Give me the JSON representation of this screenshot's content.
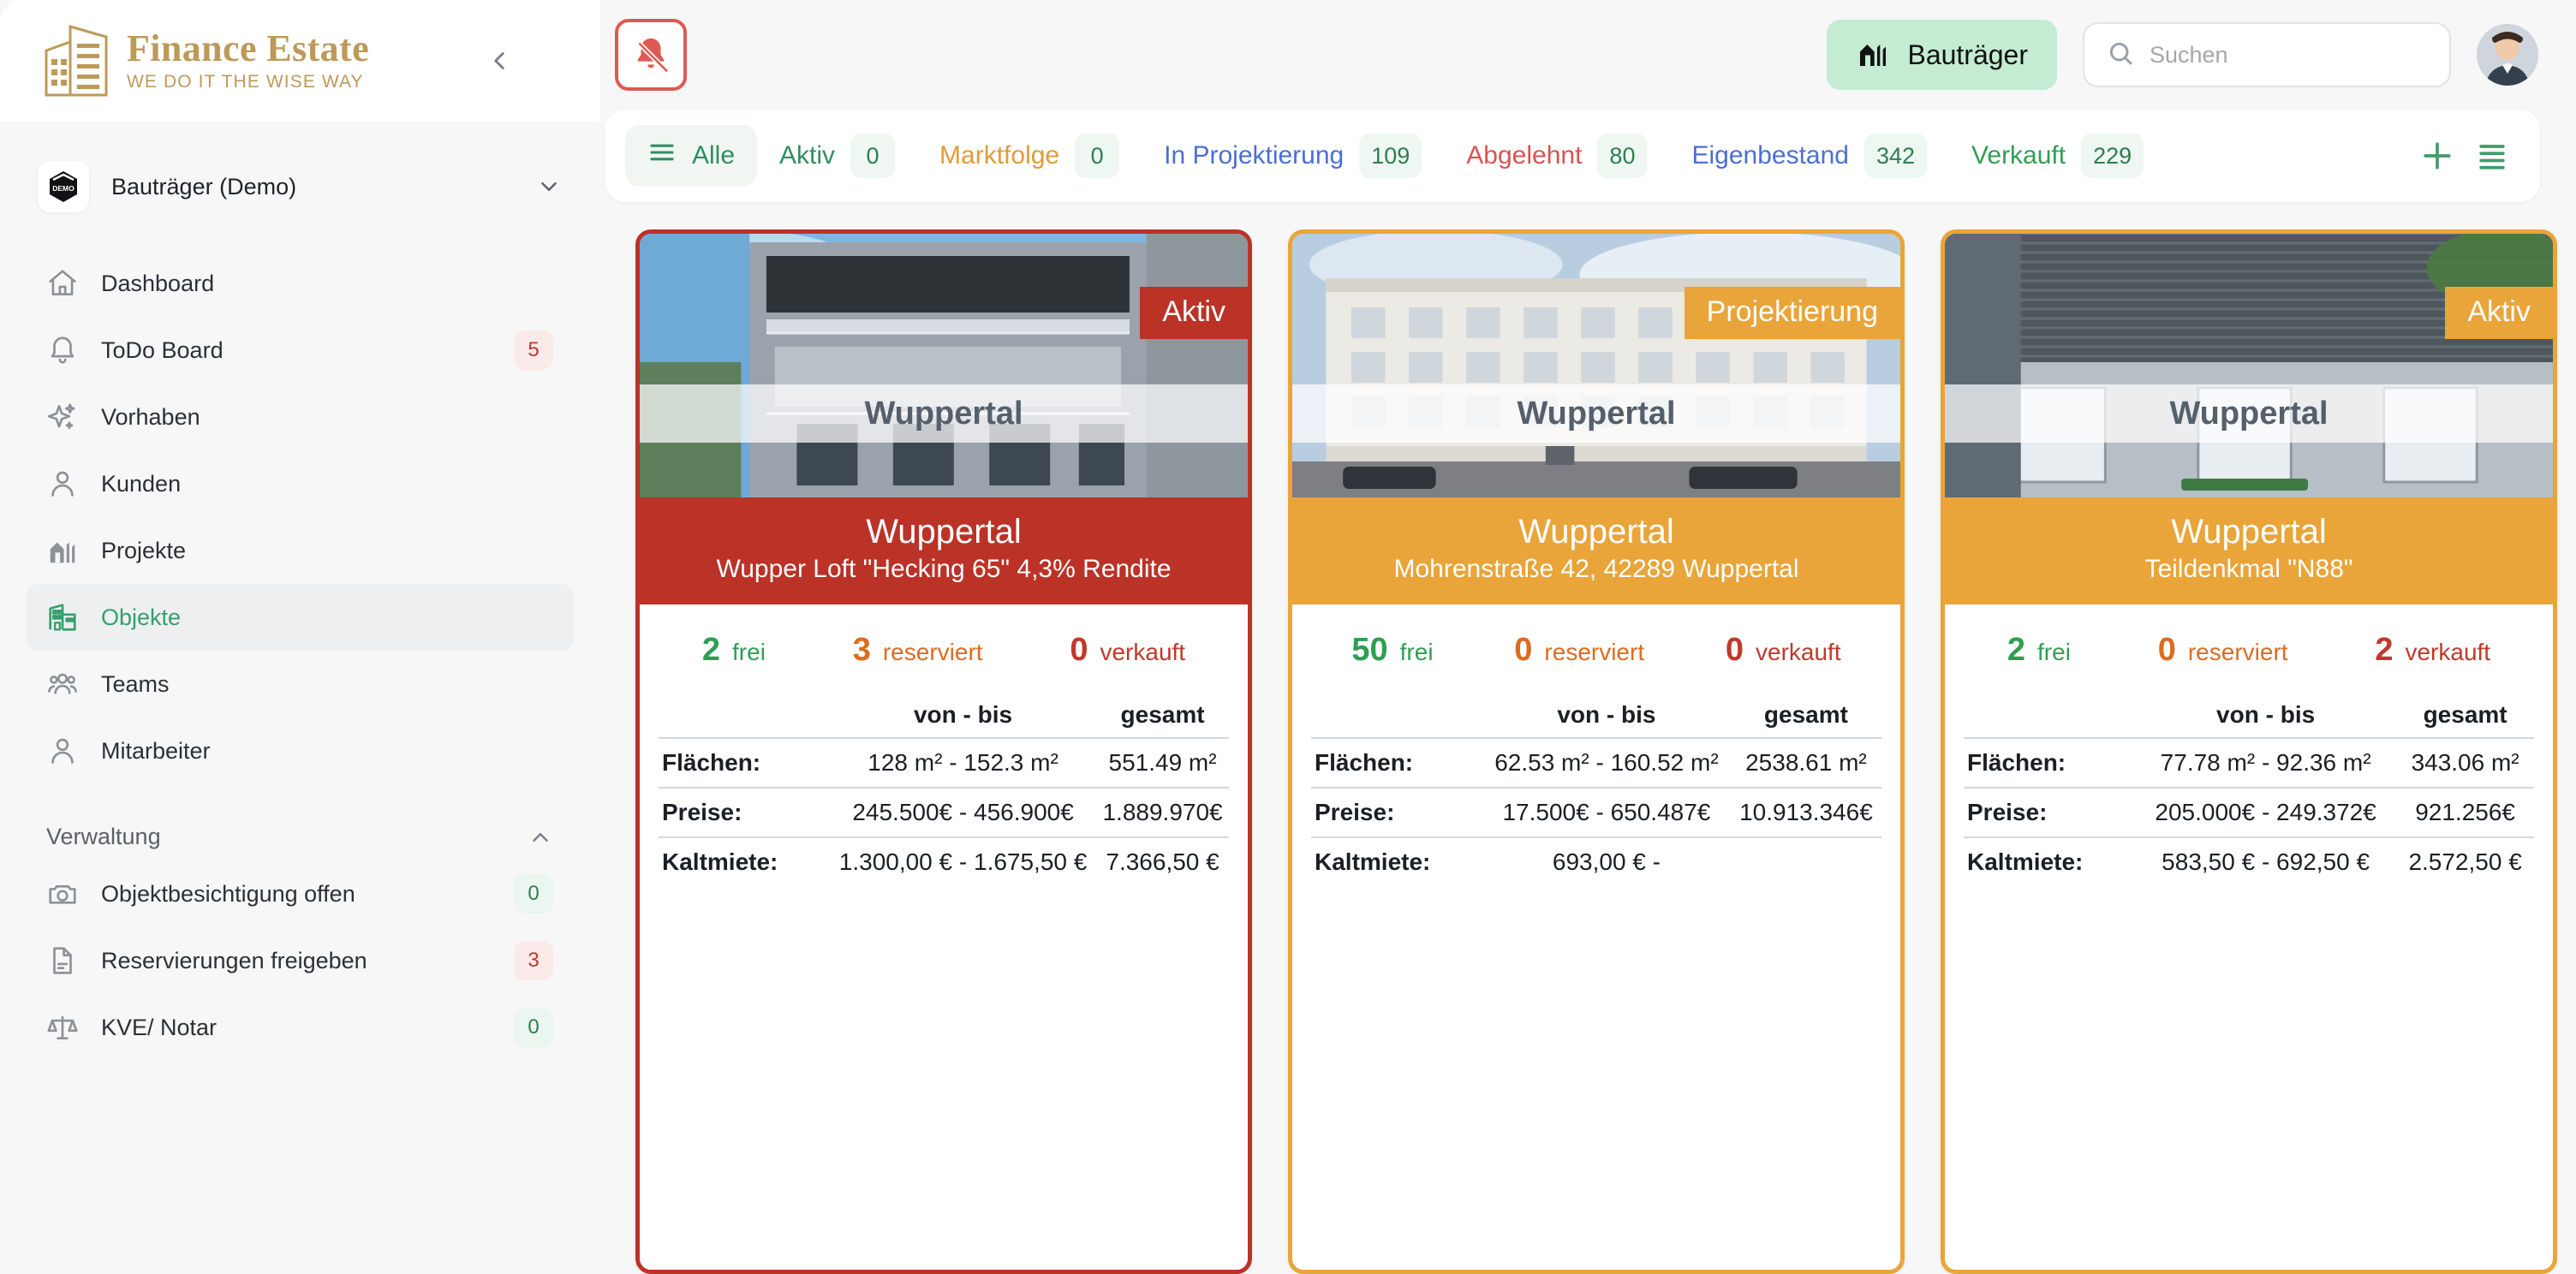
{
  "brand": {
    "title": "Finance Estate",
    "tagline": "WE DO IT THE WISE WAY",
    "logo_icon": "building-logo-icon",
    "collapse_icon": "chevron-left-icon"
  },
  "org": {
    "name": "Bauträger (Demo)",
    "logo_text": "DEMO",
    "chevron_icon": "chevron-down-icon"
  },
  "sidebar": {
    "items": [
      {
        "label": "Dashboard",
        "icon": "home-icon",
        "badge": null,
        "badge_color": null,
        "active": false
      },
      {
        "label": "ToDo Board",
        "icon": "bell-icon",
        "badge": "5",
        "badge_color": "red",
        "active": false
      },
      {
        "label": "Vorhaben",
        "icon": "sparkles-icon",
        "badge": null,
        "badge_color": null,
        "active": false
      },
      {
        "label": "Kunden",
        "icon": "user-icon",
        "badge": null,
        "badge_color": null,
        "active": false
      },
      {
        "label": "Projekte",
        "icon": "projects-icon",
        "badge": null,
        "badge_color": null,
        "active": false
      },
      {
        "label": "Objekte",
        "icon": "building-icon",
        "badge": null,
        "badge_color": null,
        "active": true
      },
      {
        "label": "Teams",
        "icon": "users-icon",
        "badge": null,
        "badge_color": null,
        "active": false
      },
      {
        "label": "Mitarbeiter",
        "icon": "user-icon",
        "badge": null,
        "badge_color": null,
        "active": false
      }
    ],
    "section": {
      "title": "Verwaltung",
      "chevron_icon": "chevron-up-icon",
      "items": [
        {
          "label": "Objektbesichtigung offen",
          "icon": "camera-icon",
          "badge": "0",
          "badge_color": "green"
        },
        {
          "label": "Reservierungen freigeben",
          "icon": "document-icon",
          "badge": "3",
          "badge_color": "red"
        },
        {
          "label": "KVE/ Notar",
          "icon": "scales-icon",
          "badge": "0",
          "badge_color": "green"
        }
      ]
    }
  },
  "topbar": {
    "notifications_icon": "bell-off-icon",
    "role": {
      "label": "Bauträger",
      "icon": "projects-icon"
    },
    "search": {
      "placeholder": "Suchen",
      "value": "",
      "icon": "search-icon"
    },
    "avatar_icon": "avatar"
  },
  "tabs": {
    "items": [
      {
        "label": "Alle",
        "count": null,
        "color": "#2f8f5f",
        "active": true,
        "icon": "list-icon"
      },
      {
        "label": "Aktiv",
        "count": "0",
        "color": "#2f8f5f",
        "active": false,
        "icon": null
      },
      {
        "label": "Marktfolge",
        "count": "0",
        "color": "#e09c38",
        "active": false,
        "icon": null
      },
      {
        "label": "In Projektierung",
        "count": "109",
        "color": "#4a6fd4",
        "active": false,
        "icon": null
      },
      {
        "label": "Abgelehnt",
        "count": "80",
        "color": "#d9534f",
        "active": false,
        "icon": null
      },
      {
        "label": "Eigenbestand",
        "count": "342",
        "color": "#4a6fd4",
        "active": false,
        "icon": null
      },
      {
        "label": "Verkauft",
        "count": "229",
        "color": "#2f9e53",
        "active": false,
        "icon": null
      }
    ],
    "add_icon": "plus-icon",
    "view_icon": "list-view-icon"
  },
  "table_headers": {
    "blank": "",
    "range": "von - bis",
    "total": "gesamt"
  },
  "count_labels": {
    "free": "frei",
    "reserved": "reserviert",
    "sold": "verkauft"
  },
  "cards": [
    {
      "status": "Aktiv",
      "accent": "#bb3227",
      "city_overlay": "Wuppertal",
      "city": "Wuppertal",
      "subtitle": "Wupper Loft \"Hecking 65\" 4,3% Rendite",
      "free": "2",
      "reserved": "3",
      "sold": "0",
      "rows": [
        {
          "label": "Flächen:",
          "range": "128 m² - 152.3 m²",
          "total": "551.49 m²"
        },
        {
          "label": "Preise:",
          "range": "245.500€ - 456.900€",
          "total": "1.889.970€"
        },
        {
          "label": "Kaltmiete:",
          "range": "1.300,00 € - 1.675,50 €",
          "total": "7.366,50 €"
        }
      ]
    },
    {
      "status": "Projektierung",
      "accent": "#e9a43a",
      "city_overlay": "Wuppertal",
      "city": "Wuppertal",
      "subtitle": "Mohrenstraße 42, 42289 Wuppertal",
      "free": "50",
      "reserved": "0",
      "sold": "0",
      "rows": [
        {
          "label": "Flächen:",
          "range": "62.53 m² - 160.52 m²",
          "total": "2538.61 m²"
        },
        {
          "label": "Preise:",
          "range": "17.500€ - 650.487€",
          "total": "10.913.346€"
        },
        {
          "label": "Kaltmiete:",
          "range": "693,00 € -",
          "total": ""
        }
      ]
    },
    {
      "status": "Aktiv",
      "accent": "#e9a43a",
      "city_overlay": "Wuppertal",
      "city": "Wuppertal",
      "subtitle": "Teildenkmal \"N88\"",
      "free": "2",
      "reserved": "0",
      "sold": "2",
      "rows": [
        {
          "label": "Flächen:",
          "range": "77.78 m² - 92.36 m²",
          "total": "343.06 m²"
        },
        {
          "label": "Preise:",
          "range": "205.000€ - 249.372€",
          "total": "921.256€"
        },
        {
          "label": "Kaltmiete:",
          "range": "583,50 € - 692,50 €",
          "total": "2.572,50 €"
        }
      ]
    }
  ]
}
